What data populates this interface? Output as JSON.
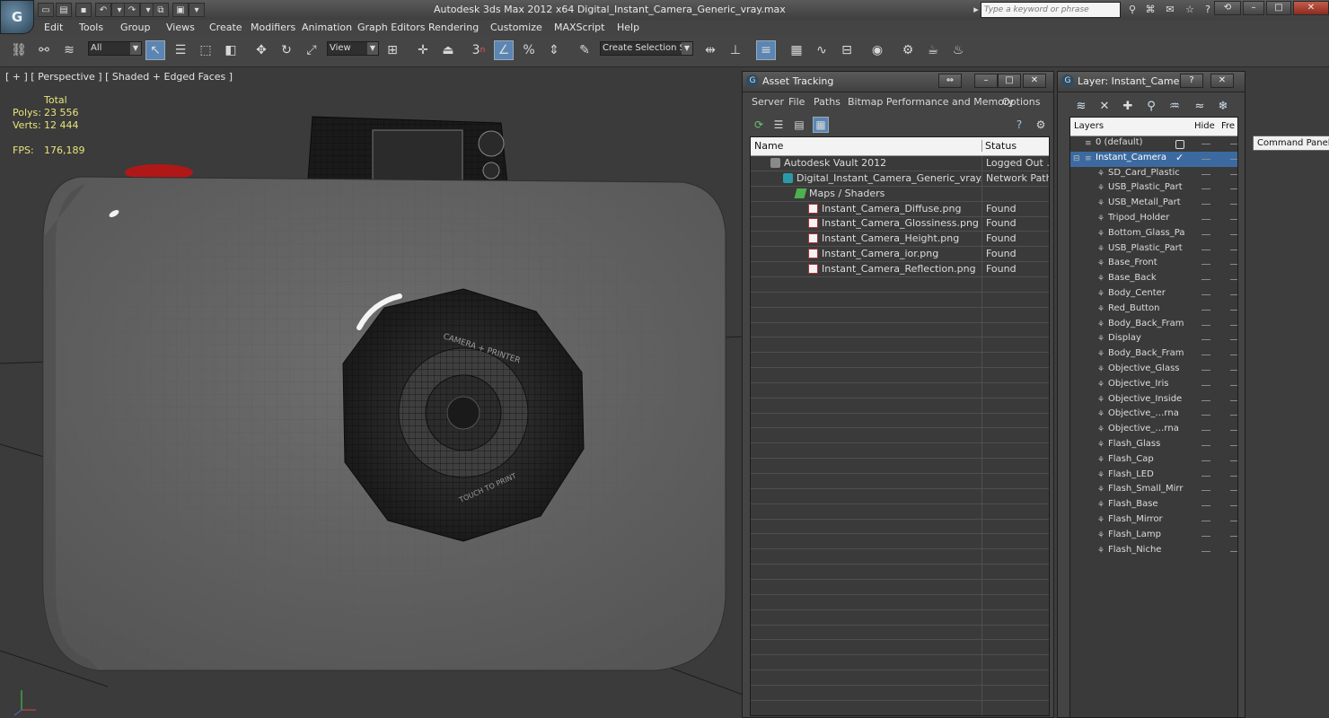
{
  "window": {
    "title": "Autodesk 3ds Max  2012 x64     Digital_Instant_Camera_Generic_vray.max",
    "search_placeholder": "Type a keyword or phrase"
  },
  "menu": [
    "Edit",
    "Tools",
    "Group",
    "Views",
    "Create",
    "Modifiers",
    "Animation",
    "Graph Editors",
    "Rendering",
    "Customize",
    "MAXScript",
    "Help"
  ],
  "toolbar": {
    "filter_value": "All",
    "ref_coord_value": "View",
    "selection_set_value": "Create Selection Se",
    "snap_label": "3",
    "snap_sub": "n"
  },
  "viewport": {
    "label": "[ + ] [ Perspective ] [ Shaded + Edged Faces ]",
    "stats": {
      "total_label": "Total",
      "polys_label": "Polys:",
      "polys_value": "23 556",
      "verts_label": "Verts:",
      "verts_value": "12 444",
      "fps_label": "FPS:",
      "fps_value": "176,189"
    },
    "lens_text_top": "CAMERA + PRINTER",
    "lens_text_bottom": "TOUCH TO PRINT"
  },
  "asset_tracking": {
    "title": "Asset Tracking",
    "menu": [
      "Server",
      "File",
      "Paths",
      "Bitmap Performance and Memory",
      "Options"
    ],
    "columns": [
      "Name",
      "Status"
    ],
    "rows": [
      {
        "name": "Autodesk Vault 2012",
        "status": "Logged Out ...",
        "indent": 1,
        "icon": "vault-icon"
      },
      {
        "name": "Digital_Instant_Camera_Generic_vray.max",
        "status": "Network Path",
        "indent": 2,
        "icon": "max-file-icon"
      },
      {
        "name": "Maps / Shaders",
        "status": "",
        "indent": 3,
        "icon": "maps-icon"
      },
      {
        "name": "Instant_Camera_Diffuse.png",
        "status": "Found",
        "indent": 4,
        "icon": "image-file-icon"
      },
      {
        "name": "Instant_Camera_Glossiness.png",
        "status": "Found",
        "indent": 4,
        "icon": "image-file-icon"
      },
      {
        "name": "Instant_Camera_Height.png",
        "status": "Found",
        "indent": 4,
        "icon": "image-file-icon"
      },
      {
        "name": "Instant_Camera_ior.png",
        "status": "Found",
        "indent": 4,
        "icon": "image-file-icon"
      },
      {
        "name": "Instant_Camera_Reflection.png",
        "status": "Found",
        "indent": 4,
        "icon": "image-file-icon"
      }
    ]
  },
  "layer_panel": {
    "title": "Layer: Instant_Camera",
    "columns": [
      "Layers",
      "Hide",
      "Fre"
    ],
    "layers": [
      {
        "name": "0 (default)",
        "level": 0,
        "selected": false
      },
      {
        "name": "Instant_Camera",
        "level": 0,
        "selected": true
      },
      {
        "name": "SD_Card_Plastic",
        "level": 1
      },
      {
        "name": "USB_Plastic_Part",
        "level": 1
      },
      {
        "name": "USB_Metall_Part",
        "level": 1
      },
      {
        "name": "Tripod_Holder",
        "level": 1
      },
      {
        "name": "Bottom_Glass_Pa",
        "level": 1
      },
      {
        "name": "USB_Plastic_Part",
        "level": 1
      },
      {
        "name": "Base_Front",
        "level": 1
      },
      {
        "name": "Base_Back",
        "level": 1
      },
      {
        "name": "Body_Center",
        "level": 1
      },
      {
        "name": "Red_Button",
        "level": 1
      },
      {
        "name": "Body_Back_Fram",
        "level": 1
      },
      {
        "name": "Display",
        "level": 1
      },
      {
        "name": "Body_Back_Fram",
        "level": 1
      },
      {
        "name": "Objective_Glass",
        "level": 1
      },
      {
        "name": "Objective_Iris",
        "level": 1
      },
      {
        "name": "Objective_Inside",
        "level": 1
      },
      {
        "name": "Objective_…rna",
        "level": 1
      },
      {
        "name": "Objective_…rna",
        "level": 1
      },
      {
        "name": "Flash_Glass",
        "level": 1
      },
      {
        "name": "Flash_Cap",
        "level": 1
      },
      {
        "name": "Flash_LED",
        "level": 1
      },
      {
        "name": "Flash_Small_Mirr",
        "level": 1
      },
      {
        "name": "Flash_Base",
        "level": 1
      },
      {
        "name": "Flash_Mirror",
        "level": 1
      },
      {
        "name": "Flash_Lamp",
        "level": 1
      },
      {
        "name": "Flash_Niche",
        "level": 1
      }
    ]
  },
  "tooltip": "Command Panel",
  "colors": {
    "stats": "#e8e57a",
    "selection": "#3c6aa0",
    "accent_button": "#5b86b3"
  }
}
